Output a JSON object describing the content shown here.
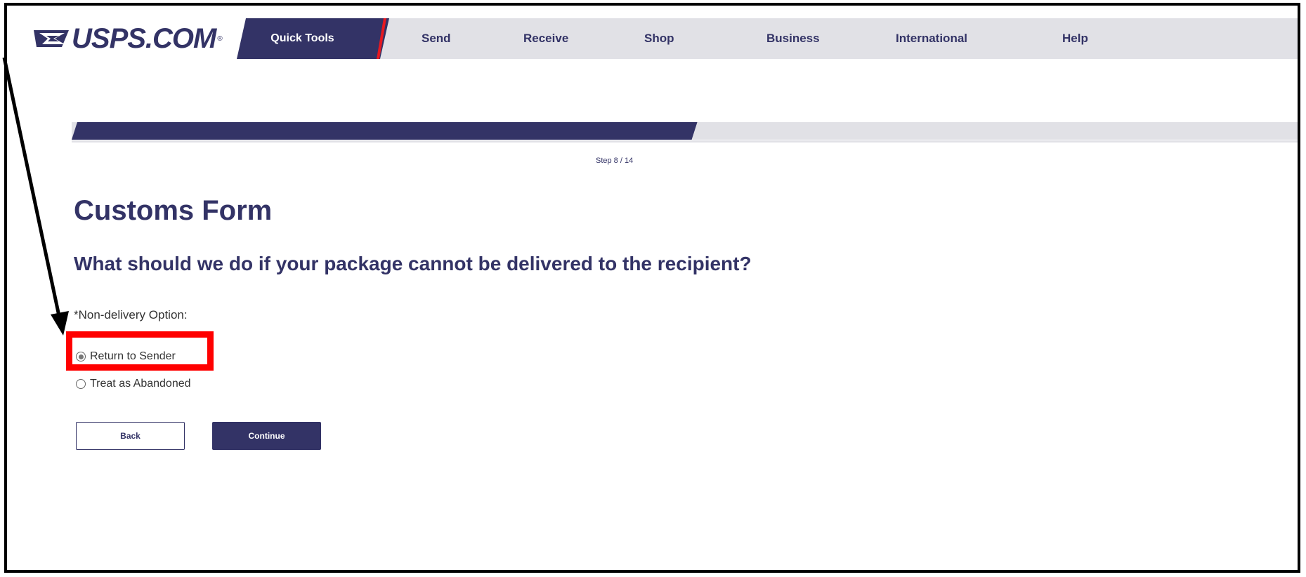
{
  "brand": {
    "logo_text": "USPS.COM",
    "reg_mark": "®"
  },
  "nav": {
    "quick_tools": "Quick Tools",
    "items": [
      "Send",
      "Receive",
      "Shop",
      "Business",
      "International",
      "Help"
    ]
  },
  "progress": {
    "step_text": "Step 8 / 14",
    "fraction": 0.506
  },
  "page": {
    "title": "Customs Form",
    "question": "What should we do if your package cannot be delivered to the recipient?"
  },
  "form": {
    "field_label": "*Non-delivery Option:",
    "options": [
      {
        "label": "Return to Sender",
        "selected": true
      },
      {
        "label": "Treat as Abandoned",
        "selected": false
      }
    ]
  },
  "buttons": {
    "back": "Back",
    "continue": "Continue"
  },
  "colors": {
    "navy": "#333366",
    "red": "#e71921",
    "annotation": "#ff0000",
    "light_gray": "#e1e1e6"
  }
}
